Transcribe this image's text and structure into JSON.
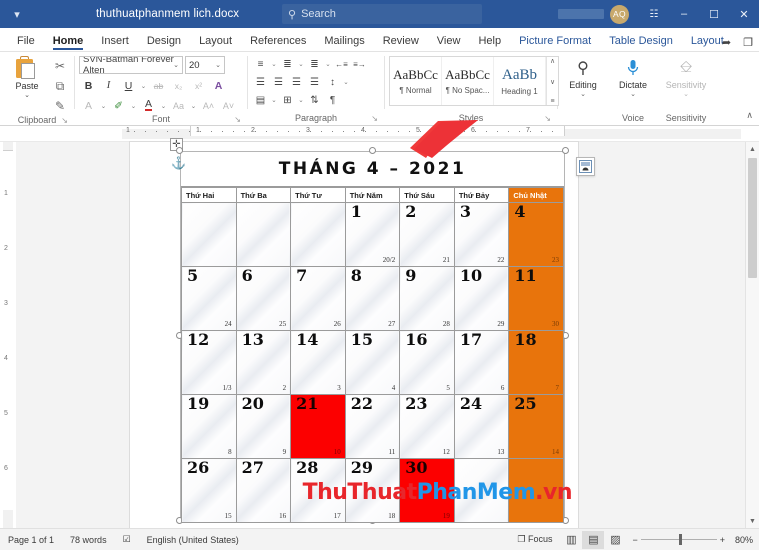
{
  "titlebar": {
    "save_icon": "save-autosave-icon",
    "document_title": "thuthuatphanmem lich.docx",
    "search_placeholder": "Search",
    "search_icon": "search-icon",
    "account_initials": "AQ",
    "ribbon_display_icon": "ribbon-display-options-icon",
    "minimize_icon": "–",
    "maximize_icon": "☐",
    "close_icon": "✕"
  },
  "tabs": [
    {
      "label": "File",
      "state": "normal"
    },
    {
      "label": "Home",
      "state": "active"
    },
    {
      "label": "Insert",
      "state": "normal"
    },
    {
      "label": "Design",
      "state": "normal"
    },
    {
      "label": "Layout",
      "state": "normal"
    },
    {
      "label": "References",
      "state": "normal"
    },
    {
      "label": "Mailings",
      "state": "normal"
    },
    {
      "label": "Review",
      "state": "normal"
    },
    {
      "label": "View",
      "state": "normal"
    },
    {
      "label": "Help",
      "state": "normal"
    },
    {
      "label": "Picture Format",
      "state": "contextual"
    },
    {
      "label": "Table Design",
      "state": "contextual"
    },
    {
      "label": "Layout",
      "state": "contextual"
    }
  ],
  "tabrow_right": {
    "share_icon": "➦",
    "comments_icon": "❐"
  },
  "ribbon": {
    "clipboard": {
      "group_label": "Clipboard",
      "paste_label": "Paste",
      "paste_chevron": "⌄",
      "cut_icon": "✂",
      "copy_icon": "⧉",
      "format_painter_icon": "✎",
      "launcher": "↘"
    },
    "font": {
      "group_label": "Font",
      "font_name": "SVN-Batman Forever Alten",
      "font_size": "20",
      "chevron": "⌄",
      "bold": "B",
      "italic": "I",
      "underline": "U",
      "strikethrough": "ab",
      "subscript": "x₂",
      "superscript": "x²",
      "text_effects": "A",
      "text_highlight": "✐",
      "font_color": "A",
      "change_case": "Aa",
      "grow_font": "A˄",
      "shrink_font": "A˅",
      "clear_formatting": "A",
      "launcher": "↘"
    },
    "paragraph": {
      "group_label": "Paragraph",
      "bullets_icon": "≡",
      "numbering_icon": "≣",
      "multilevel_icon": "≣",
      "decrease_indent_icon": "←≡",
      "increase_indent_icon": "≡→",
      "align_left_icon": "☰",
      "align_center_icon": "☰",
      "align_right_icon": "☰",
      "justify_icon": "☰",
      "line_spacing_icon": "↕",
      "shading_icon": "▤",
      "borders_icon": "⊞",
      "sort_icon": "⇅",
      "show_marks_icon": "¶",
      "launcher": "↘"
    },
    "styles": {
      "group_label": "Styles",
      "items": [
        {
          "preview": "AaBbCc",
          "name": "¶ Normal"
        },
        {
          "preview": "AaBbCc",
          "name": "¶ No Spac..."
        },
        {
          "preview": "AaBb",
          "name": "Heading 1"
        }
      ],
      "scroll_up": "∧",
      "scroll_down": "∨",
      "more": "≡",
      "launcher": "↘"
    },
    "editing": {
      "group_label": "",
      "label": "Editing",
      "icon": "⌕",
      "chevron": "⌄"
    },
    "voice": {
      "group_label": "Voice",
      "label": "Dictate",
      "icon": "⬛",
      "chevron": "⌄"
    },
    "sensitivity": {
      "group_label": "Sensitivity",
      "label": "Sensitivity",
      "icon": "⊘",
      "chevron": "⌄"
    },
    "collapse_icon": "∧"
  },
  "ruler": {
    "h_ticks": [
      "1",
      "1",
      "2",
      "3",
      "4",
      "5",
      "6",
      "7"
    ],
    "v_ticks": [
      "1",
      "2",
      "3",
      "4",
      "5",
      "6"
    ]
  },
  "document": {
    "table_move_handle_icon": "✛",
    "anchor_icon": "⚓",
    "layout_options_icon": "layout-options-icon",
    "arrow_annotation": "red-down-left-arrow"
  },
  "calendar": {
    "title": "THÁNG 4 – 2021",
    "weekdays": [
      "Thứ Hai",
      "Thứ Ba",
      "Thứ Tư",
      "Thứ Năm",
      "Thứ Sáu",
      "Thứ Bảy",
      "Chủ Nhật"
    ],
    "sunday_color": "#E8740C",
    "holiday_color": "#FC0000",
    "weeks": [
      [
        {
          "day": "",
          "lunar": "",
          "style": ""
        },
        {
          "day": "",
          "lunar": "",
          "style": ""
        },
        {
          "day": "",
          "lunar": "",
          "style": ""
        },
        {
          "day": "1",
          "lunar": "20/2",
          "style": ""
        },
        {
          "day": "2",
          "lunar": "21",
          "style": ""
        },
        {
          "day": "3",
          "lunar": "22",
          "style": ""
        },
        {
          "day": "4",
          "lunar": "23",
          "style": "sun"
        }
      ],
      [
        {
          "day": "5",
          "lunar": "24",
          "style": ""
        },
        {
          "day": "6",
          "lunar": "25",
          "style": ""
        },
        {
          "day": "7",
          "lunar": "26",
          "style": ""
        },
        {
          "day": "8",
          "lunar": "27",
          "style": ""
        },
        {
          "day": "9",
          "lunar": "28",
          "style": ""
        },
        {
          "day": "10",
          "lunar": "29",
          "style": ""
        },
        {
          "day": "11",
          "lunar": "30",
          "style": "sun"
        }
      ],
      [
        {
          "day": "12",
          "lunar": "1/3",
          "style": ""
        },
        {
          "day": "13",
          "lunar": "2",
          "style": ""
        },
        {
          "day": "14",
          "lunar": "3",
          "style": ""
        },
        {
          "day": "15",
          "lunar": "4",
          "style": ""
        },
        {
          "day": "16",
          "lunar": "5",
          "style": ""
        },
        {
          "day": "17",
          "lunar": "6",
          "style": ""
        },
        {
          "day": "18",
          "lunar": "7",
          "style": "sun"
        }
      ],
      [
        {
          "day": "19",
          "lunar": "8",
          "style": ""
        },
        {
          "day": "20",
          "lunar": "9",
          "style": ""
        },
        {
          "day": "21",
          "lunar": "10",
          "style": "hol"
        },
        {
          "day": "22",
          "lunar": "11",
          "style": ""
        },
        {
          "day": "23",
          "lunar": "12",
          "style": ""
        },
        {
          "day": "24",
          "lunar": "13",
          "style": ""
        },
        {
          "day": "25",
          "lunar": "14",
          "style": "sun"
        }
      ],
      [
        {
          "day": "26",
          "lunar": "15",
          "style": ""
        },
        {
          "day": "27",
          "lunar": "16",
          "style": ""
        },
        {
          "day": "28",
          "lunar": "17",
          "style": ""
        },
        {
          "day": "29",
          "lunar": "18",
          "style": ""
        },
        {
          "day": "30",
          "lunar": "19",
          "style": "hol"
        },
        {
          "day": "",
          "lunar": "",
          "style": ""
        },
        {
          "day": "",
          "lunar": "",
          "style": "sun"
        }
      ]
    ]
  },
  "watermark": {
    "part1": "ThuThuat",
    "part2": "PhanMem",
    "part3": ".vn"
  },
  "status": {
    "page": "Page 1 of 1",
    "words": "78 words",
    "proofing_icon": "☑",
    "language": "English (United States)",
    "focus_icon": "❐",
    "focus_label": "Focus",
    "read_mode_icon": "▥",
    "print_layout_icon": "▤",
    "web_layout_icon": "▨",
    "zoom_out": "−",
    "zoom_in": "+",
    "zoom_level": "80%"
  },
  "scrollbar": {
    "up_icon": "▲",
    "down_icon": "▼"
  }
}
